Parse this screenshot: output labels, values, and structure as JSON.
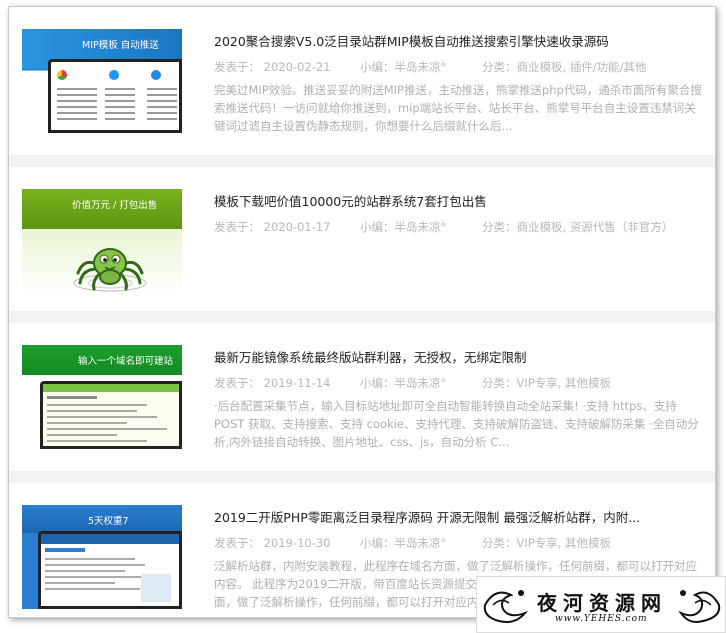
{
  "posts": [
    {
      "title": "2020聚合搜索V5.0泛目录站群MIP模板自动推送搜索引擎快速收录源码",
      "date": "发表于： 2020-02-21",
      "author": "小编：半岛未凉°",
      "cat_prefix": "分类：",
      "categories": [
        "商业模板",
        "插件/功能/其他"
      ],
      "cat_sep": ", ",
      "excerpt": "完美过MIP效验。推送妥妥的附送MIP推送，主动推送，熊掌推送php代码，通杀市面所有聚合搜索推送代码！一访问就给你推送到，mip端站长平台、站长平台、熊掌号平台自主设置违禁词关键词过滤自主设置伪静态规则，你想要什么后缀就什么后...",
      "thumb_text": "MIP模板  自动推送"
    },
    {
      "title": "模板下载吧价值10000元的站群系统7套打包出售",
      "date": "发表于： 2020-01-17",
      "author": "小编：半岛未凉°",
      "cat_prefix": "分类：",
      "categories": [
        "商业模板",
        "资源代售（非官方）"
      ],
      "cat_sep": ", ",
      "excerpt": "",
      "thumb_text": "价值万元 / 打包出售"
    },
    {
      "title": "最新万能镜像系统最终版站群利器，无授权，无绑定限制",
      "date": "发表于： 2019-11-14",
      "author": "小编：半岛未凉°",
      "cat_prefix": "分类：",
      "categories": [
        "VIP专享",
        "其他模板"
      ],
      "cat_sep": ", ",
      "excerpt": "·后台配置采集节点，输入目标站地址即可全自动智能转换自动全站采集! ·支持 https、支持 POST 获取、支持搜索、支持 cookie、支持代理、支持破解防盗链、支持破解防采集 ·全自动分析,内外链接自动转换、图片地址、css、js，自动分析 C...",
      "thumb_text": "输入一个域名即可建站"
    },
    {
      "title": "2019二开版PHP零距离泛目录程序源码 开源无限制 最强泛解析站群，内附...",
      "date": "发表于： 2019-10-30",
      "author": "小编：半岛未凉°",
      "cat_prefix": "分类：",
      "categories": [
        "VIP专享",
        "其他模板"
      ],
      "cat_sep": ", ",
      "excerpt": "泛解析站群，内附安装教程，此程序在域名方面，做了泛解析操作，任何前缀，都可以打开对应内容。 此程序为2019二开版，带百度站长资源提交工具，配合泛解析操作，此程序在域名方面，做了泛解析操作，任何前缀，都可以打开对应内容。此程序...",
      "thumb_text": "5天权重7"
    }
  ],
  "watermark": {
    "text": "夜河资源网",
    "url": "www.YEHES.com"
  }
}
